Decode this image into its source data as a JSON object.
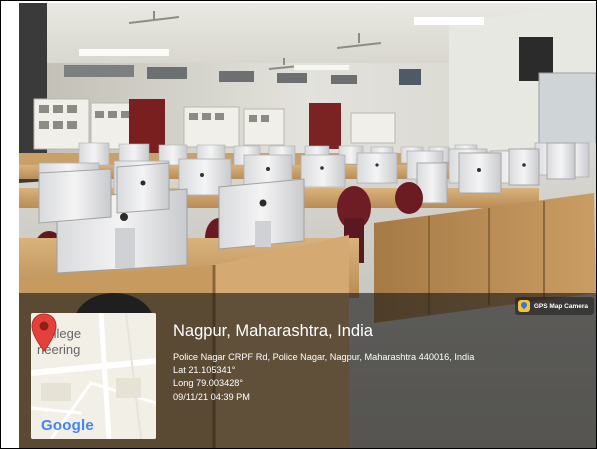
{
  "gps_overlay": {
    "camera_badge": "GPS Map Camera",
    "location_title": "Nagpur, Maharashtra, India",
    "address": "Police Nagar CRPF Rd, Police Nagar, Nagpur, Maharashtra 440016, India",
    "latitude": "Lat 21.105341°",
    "longitude": "Long 79.003428°",
    "timestamp": "09/11/21 04:39 PM",
    "map": {
      "label_line1": "College",
      "label_line2": "neering",
      "provider_logo": "Google",
      "pin_icon": "map-pin-icon",
      "logo_colors": [
        "#4285F4",
        "#EA4335",
        "#FBBC05",
        "#4285F4",
        "#34A853",
        "#EA4335"
      ]
    }
  }
}
